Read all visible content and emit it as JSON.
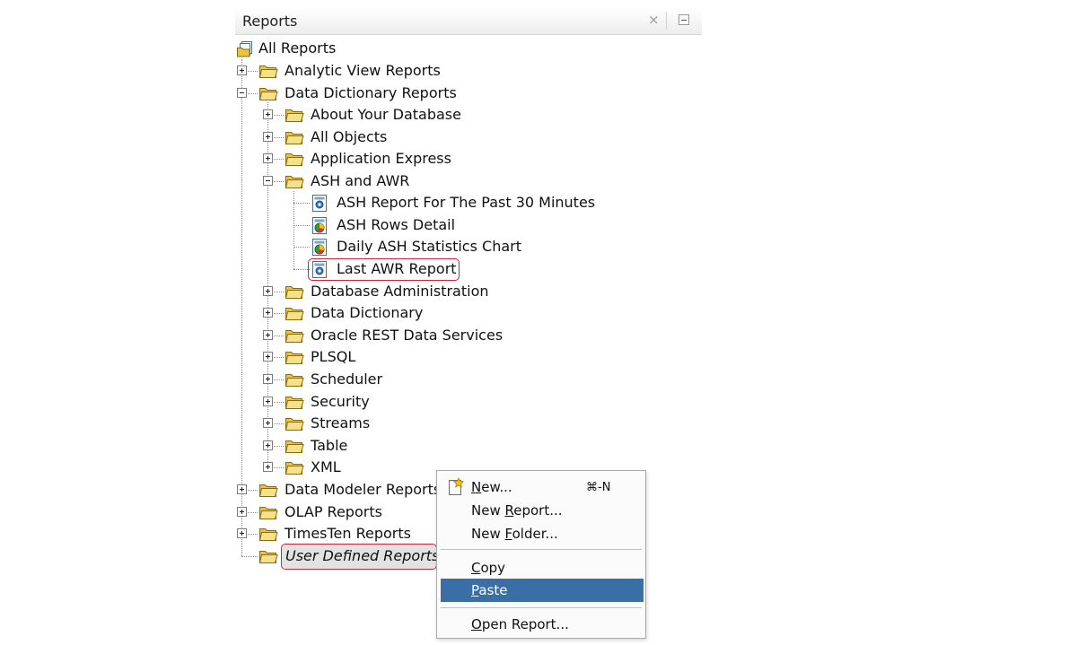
{
  "panel": {
    "title": "Reports",
    "close_glyph": "×"
  },
  "tree": {
    "root": "All Reports",
    "level1_top": [
      "Analytic View Reports",
      "Data Dictionary Reports"
    ],
    "data_dictionary_children": [
      "About Your Database",
      "All Objects",
      "Application Express",
      "ASH and AWR"
    ],
    "ash_awr_reports": [
      "ASH Report For The Past 30 Minutes",
      "ASH Rows Detail",
      "Daily ASH Statistics Chart",
      "Last AWR Report"
    ],
    "data_dictionary_children_more": [
      "Database Administration",
      "Data Dictionary",
      "Oracle REST Data Services",
      "PLSQL",
      "Scheduler",
      "Security",
      "Streams",
      "Table",
      "XML"
    ],
    "level1_bottom": [
      "Data Modeler Reports",
      "OLAP Reports",
      "TimesTen Reports"
    ],
    "user_defined": "User Defined Reports"
  },
  "context_menu": {
    "new": {
      "mnemonic": "N",
      "rest": "ew...",
      "shortcut": "⌘-N"
    },
    "new_report": {
      "pre": "New ",
      "mnemonic": "R",
      "rest": "eport..."
    },
    "new_folder": {
      "pre": "New ",
      "mnemonic": "F",
      "rest": "older..."
    },
    "copy": {
      "mnemonic": "C",
      "rest": "opy"
    },
    "paste": {
      "mnemonic": "P",
      "rest": "aste"
    },
    "open_report": {
      "mnemonic": "O",
      "rest": "pen Report..."
    }
  },
  "colors": {
    "highlight_border": "#c8253a",
    "menu_selection": "#3a6fa5",
    "folder_fill": "#f1d45a"
  }
}
